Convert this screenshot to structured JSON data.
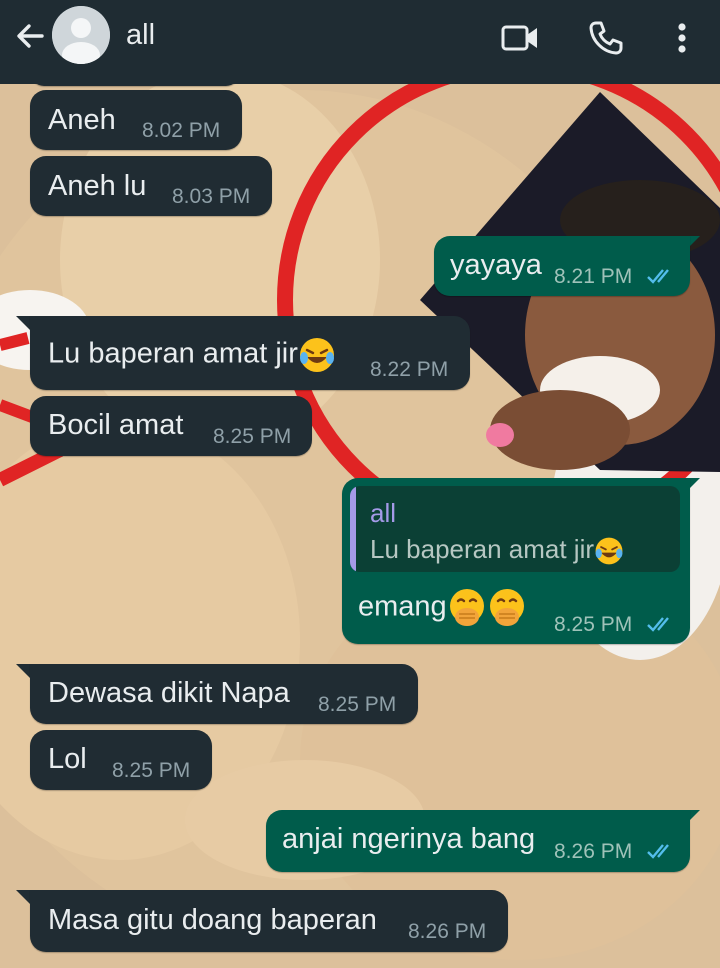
{
  "header": {
    "contact_name": "all",
    "icons": [
      "back-arrow-icon",
      "avatar-placeholder-icon",
      "video-call-icon",
      "phone-call-icon",
      "more-vert-icon"
    ]
  },
  "messages": [
    {
      "direction": "in",
      "text": "Aneh",
      "time": "8.02 PM"
    },
    {
      "direction": "in",
      "text": "Aneh lu",
      "time": "8.03 PM"
    },
    {
      "direction": "out",
      "text": "yayaya",
      "time": "8.21 PM",
      "status": "read"
    },
    {
      "direction": "in",
      "text": "Lu baperan amat jir",
      "emoji": "face-with-tears-of-joy",
      "time": "8.22 PM"
    },
    {
      "direction": "in",
      "text": "Bocil amat",
      "time": "8.25 PM"
    },
    {
      "direction": "out",
      "text": "emang",
      "emoji": "face-with-hand-over-mouth x2",
      "time": "8.25 PM",
      "status": "read",
      "quote": {
        "name": "all",
        "text": "Lu baperan amat jir",
        "emoji": "face-with-tears-of-joy"
      }
    },
    {
      "direction": "in",
      "text": "Dewasa dikit Napa",
      "time": "8.25 PM"
    },
    {
      "direction": "in",
      "text": "Lol",
      "time": "8.25 PM"
    },
    {
      "direction": "out",
      "text": "anjai ngerinya bang",
      "time": "8.26 PM",
      "status": "read"
    },
    {
      "direction": "in",
      "text": "Masa gitu doang baperan",
      "time": "8.26 PM"
    }
  ],
  "colors": {
    "header_bg": "#1f2c33",
    "incoming_bubble": "#202c33",
    "outgoing_bubble": "#005c4b",
    "read_tick": "#53bdeb",
    "quote_accent": "#a59ae8",
    "wallpaper_ring": "#e02424"
  }
}
